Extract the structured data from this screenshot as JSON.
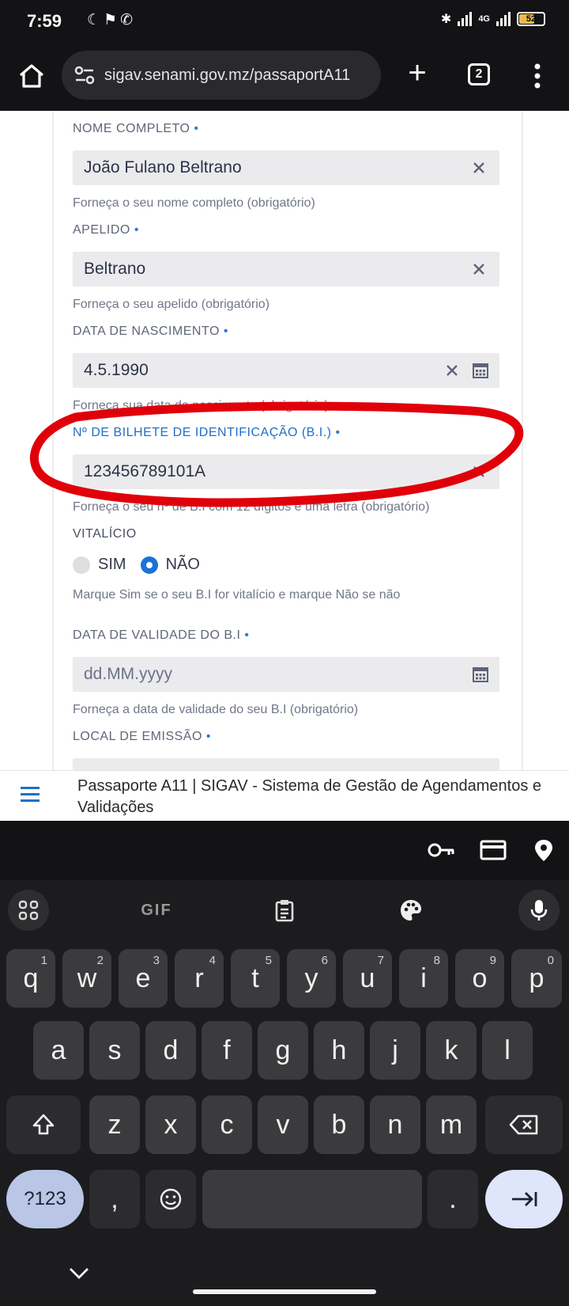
{
  "status_bar": {
    "time": "7:59",
    "network": "4G",
    "battery": "52"
  },
  "browser": {
    "url": "sigav.senami.gov.mz/passaportA11",
    "tab_count": "2"
  },
  "form": {
    "nome": {
      "label": "NOME COMPLETO",
      "value": "João Fulano Beltrano",
      "help": "Forneça o seu nome completo (obrigatório)"
    },
    "apelido": {
      "label": "APELIDO",
      "value": "Beltrano",
      "help": "Forneça o seu apelido (obrigatório)"
    },
    "nascimento": {
      "label": "DATA DE NASCIMENTO",
      "value": "4.5.1990",
      "help": "Forneça sua data de nascimento (obrigatório)"
    },
    "bi": {
      "label": "Nº DE BILHETE DE IDENTIFICAÇÃO (B.I.)",
      "value": "123456789101A",
      "help": "Forneça o seu nº de B.I com 12 dígitos e uma letra (obrigatório)"
    },
    "vitalicio": {
      "label": "VITALÍCIO",
      "options": [
        "SIM",
        "NÃO"
      ],
      "selected": "NÃO",
      "help": "Marque Sim se o seu B.I for vitalício e marque Não se não"
    },
    "validade": {
      "label": "DATA DE VALIDADE DO B.I",
      "placeholder": "dd.MM.yyyy",
      "help": "Forneça a data de validade do seu B.I (obrigatório)"
    },
    "local": {
      "label": "LOCAL DE EMISSÃO"
    },
    "required_marker": "•"
  },
  "page_bar": {
    "title": "Passaporte A11 | SIGAV - Sistema de Gestão de Agendamentos e Validações"
  },
  "colors": {
    "accent": "#1a73d9",
    "annotation": "#e0000a"
  },
  "keyboard": {
    "row1": [
      [
        "q",
        "1"
      ],
      [
        "w",
        "2"
      ],
      [
        "e",
        "3"
      ],
      [
        "r",
        "4"
      ],
      [
        "t",
        "5"
      ],
      [
        "y",
        "6"
      ],
      [
        "u",
        "7"
      ],
      [
        "i",
        "8"
      ],
      [
        "o",
        "9"
      ],
      [
        "p",
        "0"
      ]
    ],
    "row2": [
      "a",
      "s",
      "d",
      "f",
      "g",
      "h",
      "j",
      "k",
      "l"
    ],
    "row3": [
      "z",
      "x",
      "c",
      "v",
      "b",
      "n",
      "m"
    ],
    "symbols_label": "?123",
    "comma": ",",
    "period": ".",
    "gif_label": "GIF"
  }
}
